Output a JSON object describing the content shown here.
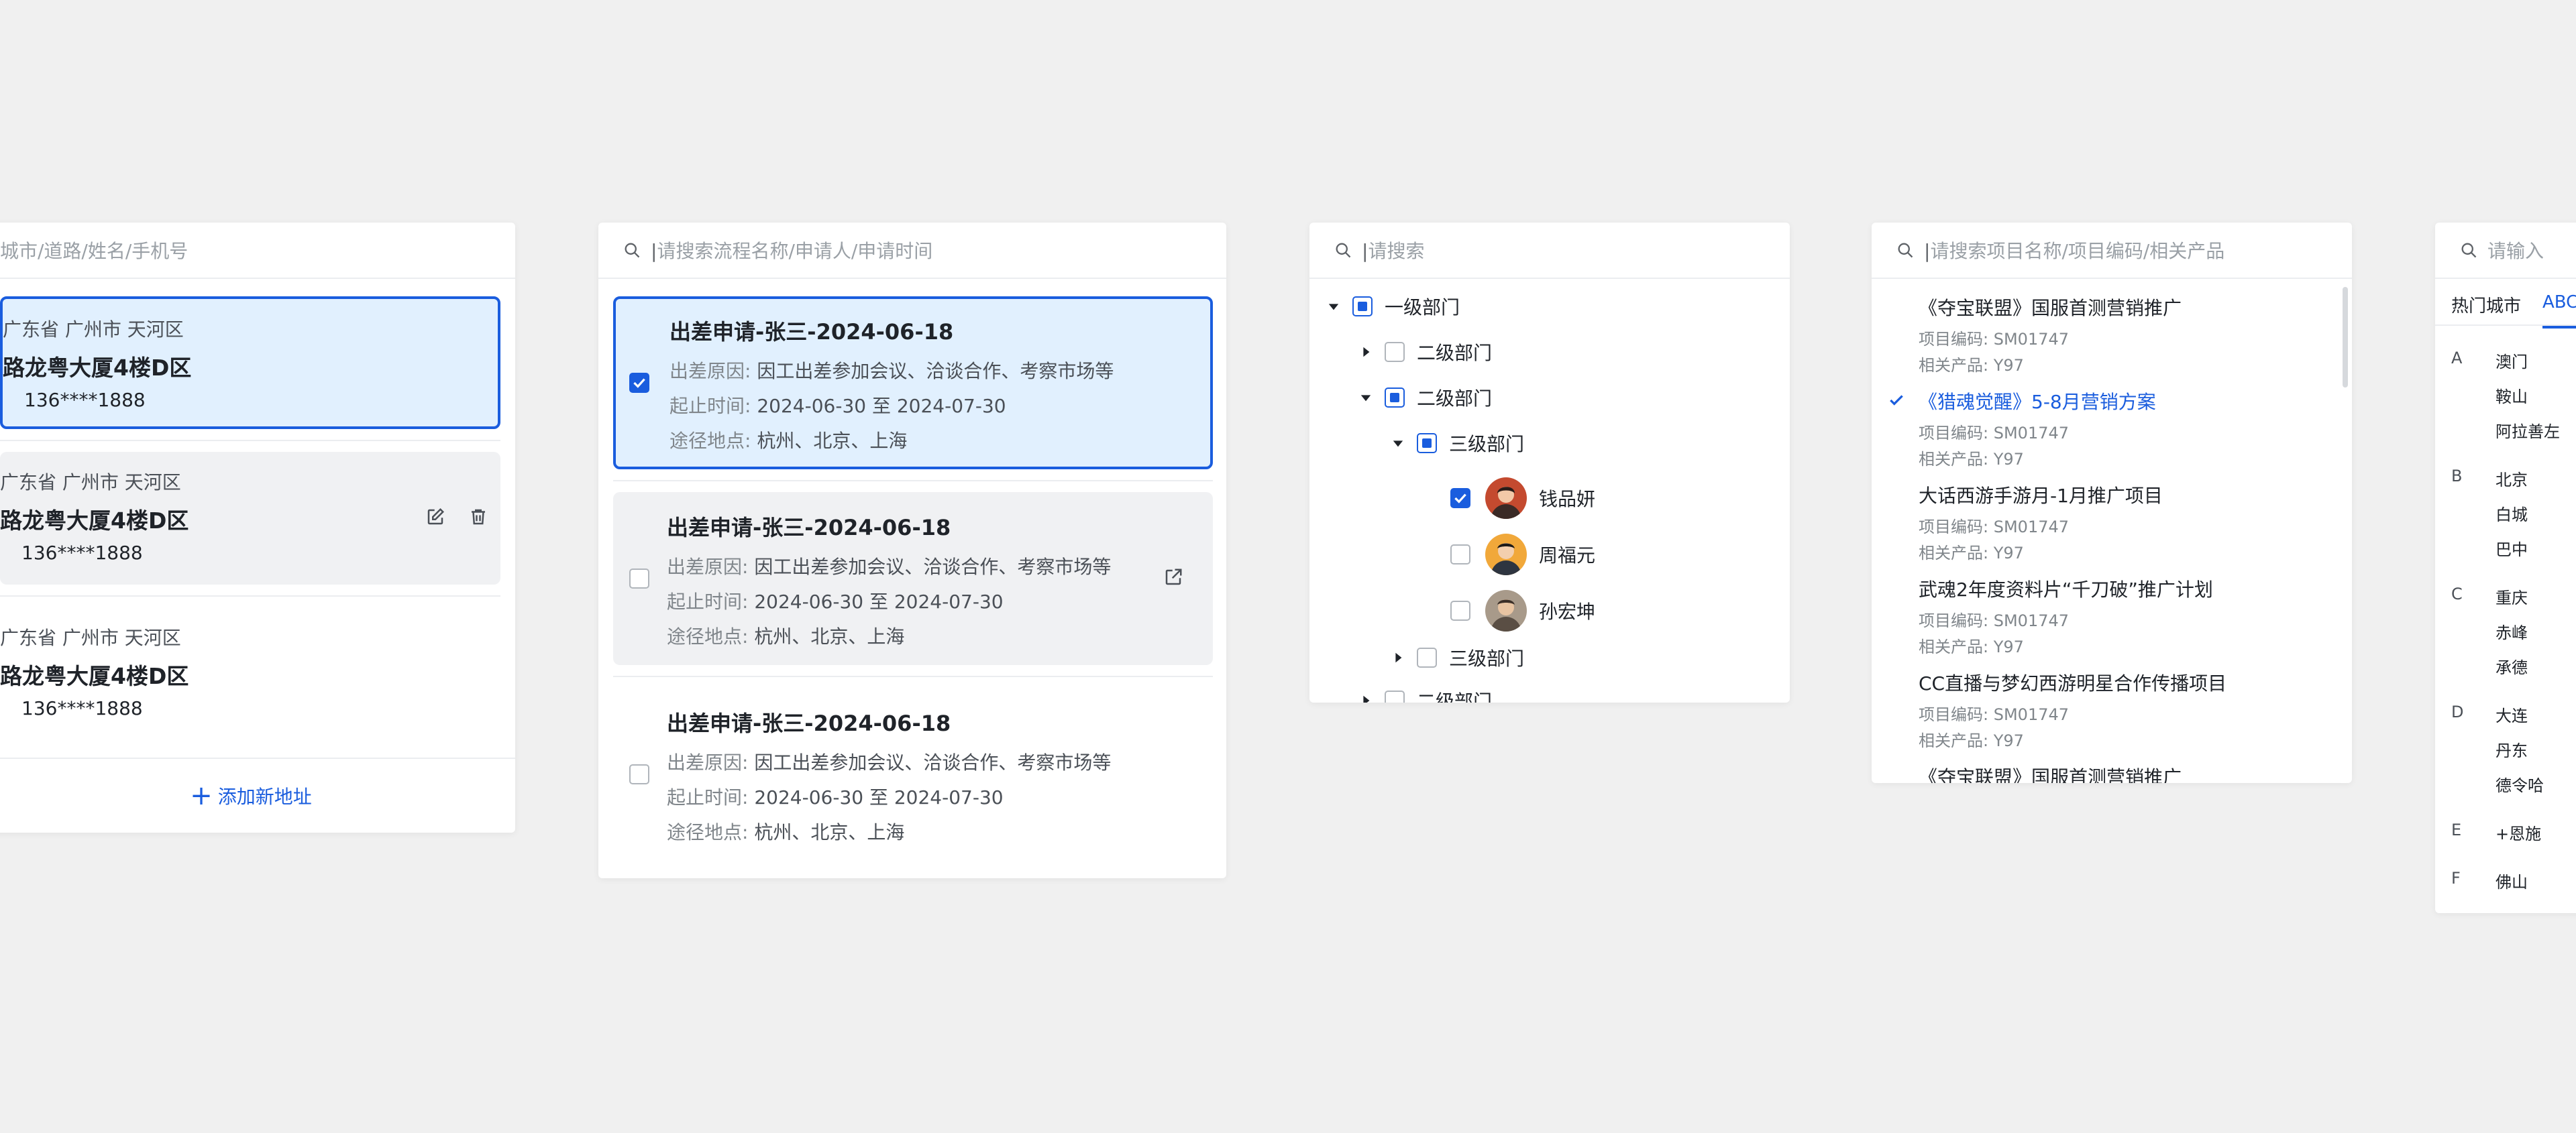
{
  "address_panel": {
    "search_placeholder": "城市/道路/姓名/手机号",
    "items": [
      {
        "region": "广东省 广州市 天河区",
        "street": "路龙粤大厦4楼D区",
        "phone": "136****1888"
      },
      {
        "region": "广东省 广州市 天河区",
        "street": "路龙粤大厦4楼D区",
        "phone": "136****1888"
      },
      {
        "region": "广东省 广州市 天河区",
        "street": "路龙粤大厦4楼D区",
        "phone": "136****1888"
      }
    ],
    "add_label": "添加新地址"
  },
  "request_panel": {
    "search_placeholder": "请搜索流程名称/申请人/申请时间",
    "items": [
      {
        "title": "出差申请-张三-2024-06-18",
        "reason_key": "出差原因:",
        "reason": "因工出差参加会议、洽谈合作、考察市场等",
        "time_key": "起止时间:",
        "time": "2024-06-30 至 2024-07-30",
        "places_key": "途径地点:",
        "places": "杭州、北京、上海"
      },
      {
        "title": "出差申请-张三-2024-06-18",
        "reason_key": "出差原因:",
        "reason": "因工出差参加会议、洽谈合作、考察市场等",
        "time_key": "起止时间:",
        "time": "2024-06-30 至 2024-07-30",
        "places_key": "途径地点:",
        "places": "杭州、北京、上海"
      },
      {
        "title": "出差申请-张三-2024-06-18",
        "reason_key": "出差原因:",
        "reason": "因工出差参加会议、洽谈合作、考察市场等",
        "time_key": "起止时间:",
        "time": "2024-06-30 至 2024-07-30",
        "places_key": "途径地点:",
        "places": "杭州、北京、上海"
      }
    ]
  },
  "tree_panel": {
    "search_placeholder": "请搜索",
    "nodes": [
      "一级部门",
      "二级部门",
      "二级部门",
      "三级部门",
      "钱品妍",
      "周福元",
      "孙宏坤",
      "三级部门",
      "二级部门"
    ]
  },
  "project_panel": {
    "search_placeholder": "请搜索项目名称/项目编码/相关产品",
    "code_key": "项目编码:",
    "product_key": "相关产品:",
    "items": [
      {
        "title": "《夺宝联盟》国服首测营销推广",
        "code": "SM01747",
        "product": "Y97"
      },
      {
        "title": "《猎魂觉醒》5-8月营销方案",
        "code": "SM01747",
        "product": "Y97"
      },
      {
        "title": "大话西游手游月-1月推广项目",
        "code": "SM01747",
        "product": "Y97"
      },
      {
        "title": "武魂2年度资料片“千刀破”推广计划",
        "code": "SM01747",
        "product": "Y97"
      },
      {
        "title": "CC直播与梦幻西游明星合作传播项目",
        "code": "SM01747",
        "product": "Y97"
      },
      {
        "title": "《夺宝联盟》国服首测营销推广",
        "code": "",
        "product": ""
      }
    ]
  },
  "city_panel": {
    "search_placeholder": "请输入",
    "tabs": [
      "热门城市",
      "ABC"
    ],
    "groups": [
      {
        "letter": "A",
        "cities": [
          "澳门",
          "鞍山",
          "阿拉善左"
        ]
      },
      {
        "letter": "B",
        "cities": [
          "北京",
          "白城",
          "巴中"
        ]
      },
      {
        "letter": "C",
        "cities": [
          "重庆",
          "赤峰",
          "承德"
        ]
      },
      {
        "letter": "D",
        "cities": [
          "大连",
          "丹东",
          "德令哈"
        ]
      },
      {
        "letter": "E",
        "cities": [
          "恩施"
        ]
      },
      {
        "letter": "F",
        "cities": [
          "佛山"
        ]
      }
    ]
  },
  "colors": {
    "accent": "#1a5dde",
    "selected_bg": "#e1f0fe",
    "hover_bg": "#f0f1f3"
  }
}
